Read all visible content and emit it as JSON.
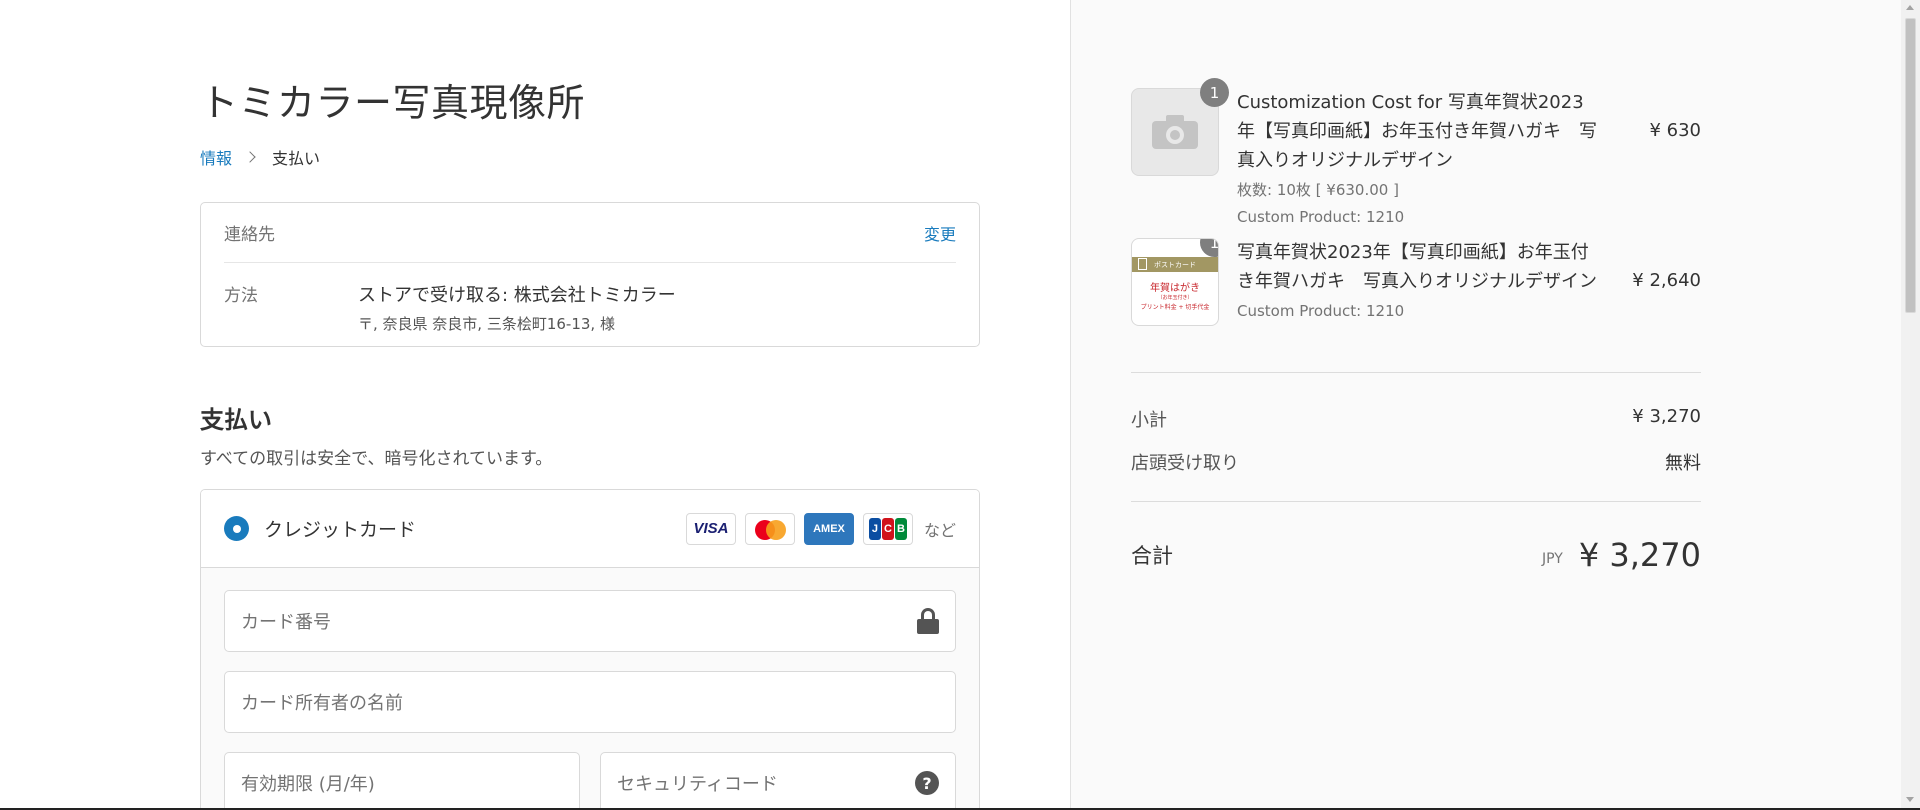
{
  "shop": {
    "title": "トミカラー写真現像所"
  },
  "breadcrumb": {
    "info": "情報",
    "current": "支払い"
  },
  "review": {
    "contact_label": "連絡先",
    "change_label": "変更",
    "method_label": "方法",
    "method_value": "ストアで受け取る: 株式会社トミカラー",
    "method_address": "〒, 奈良県 奈良市, 三条桧町16-13, 様"
  },
  "payment": {
    "title": "支払い",
    "subtitle": "すべての取引は安全で、暗号化されています。",
    "credit_card_label": "クレジットカード",
    "cards": {
      "visa": "VISA",
      "amex": "AMEX",
      "jcb_j": "J",
      "jcb_c": "C",
      "jcb_b": "B",
      "more": "など"
    },
    "card_number_placeholder": "カード番号",
    "card_name_placeholder": "カード所有者の名前",
    "expiry_placeholder": "有効期限 (月/年)",
    "security_placeholder": "セキュリティコード",
    "help_glyph": "?"
  },
  "cart": {
    "items": [
      {
        "quantity": "1",
        "name": "Customization Cost for 写真年賀状2023年【写真印画紙】お年玉付き年賀ハガキ　写真入りオリジナルデザイン",
        "meta1": "枚数: 10枚 [ ¥630.00 ]",
        "meta2": "Custom Product: 1210",
        "price": "¥ 630"
      },
      {
        "quantity": "1",
        "name": "写真年賀状2023年【写真印画紙】お年玉付き年賀ハガキ　写真入りオリジナルデザイン",
        "meta1": "Custom Product: 1210",
        "price": "¥ 2,640",
        "thumb": {
          "band": "ポストカード",
          "line1": "年賀はがき",
          "line2": "（お年玉付き）",
          "line3": "プリント料金 + 切手代金"
        }
      }
    ],
    "subtotal_label": "小計",
    "subtotal_value": "¥ 3,270",
    "pickup_label": "店頭受け取り",
    "pickup_value": "無料",
    "total_label": "合計",
    "currency": "JPY",
    "total_value": "¥ 3,270"
  }
}
